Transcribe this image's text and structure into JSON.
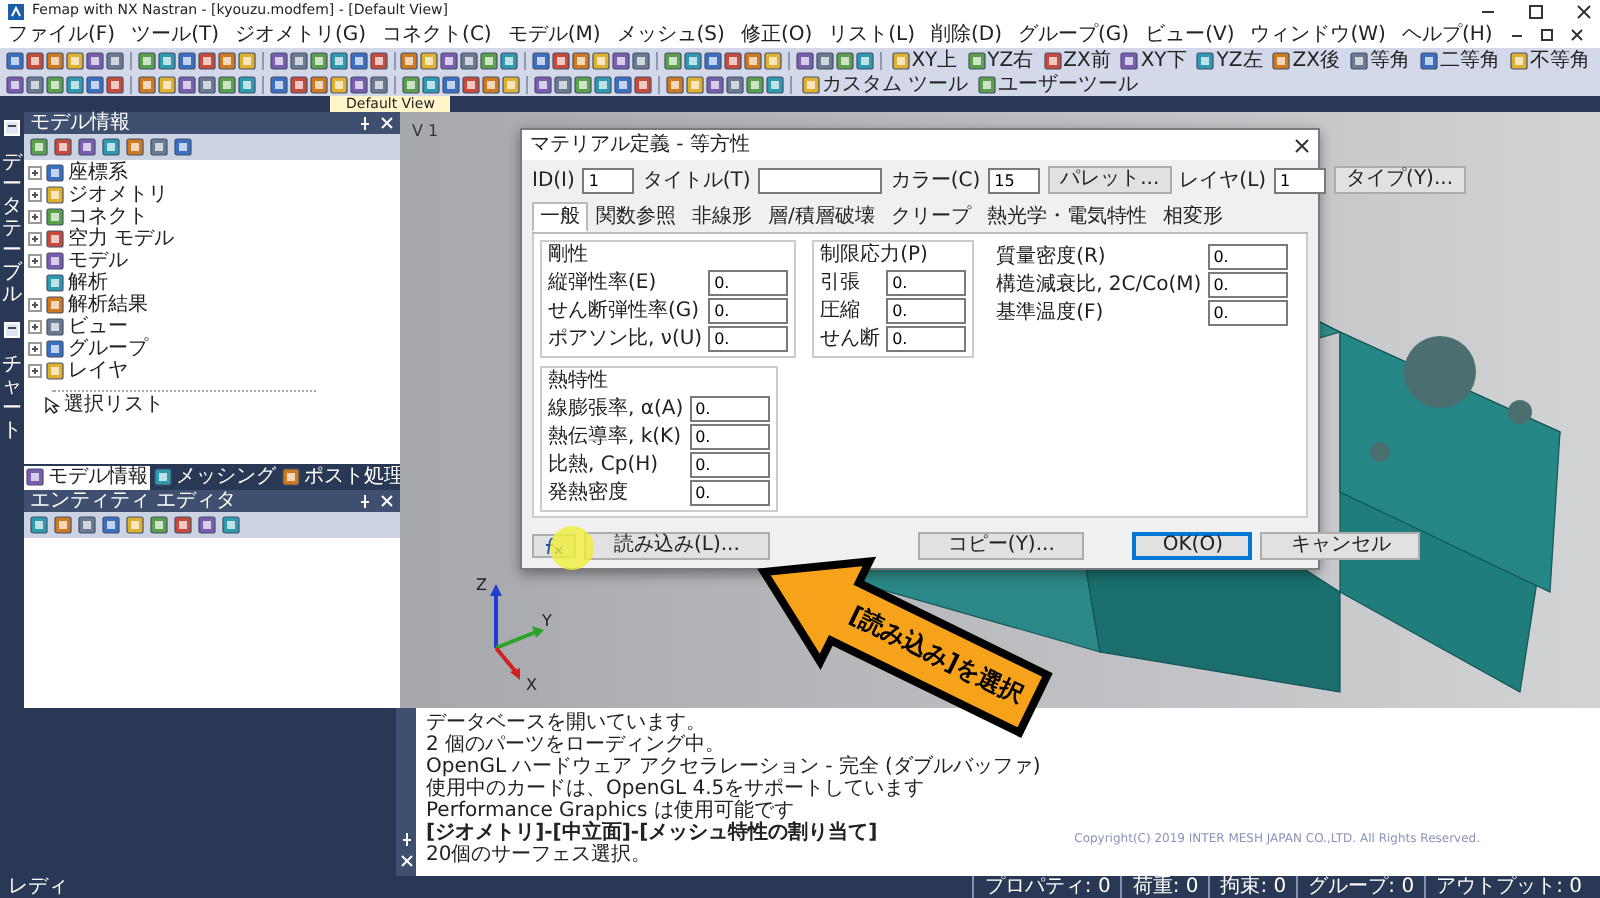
{
  "window": {
    "title": "Femap with NX Nastran - [kyouzu.modfem] - [Default View]"
  },
  "menu": [
    "ファイル(F)",
    "ツール(T)",
    "ジオメトリ(G)",
    "コネクト(C)",
    "モデル(M)",
    "メッシュ(S)",
    "修正(O)",
    "リスト(L)",
    "削除(D)",
    "グループ(G)",
    "ビュー(V)",
    "ウィンドウ(W)",
    "ヘルプ(H)"
  ],
  "view_buttons": [
    "XY上",
    "YZ右",
    "ZX前",
    "XY下",
    "YZ左",
    "ZX後",
    "等角",
    "二等角",
    "不等角"
  ],
  "tool_buttons": [
    "カスタム ツール",
    "ユーザーツール"
  ],
  "view_tabs": [
    {
      "label": "Default View",
      "selected": true
    }
  ],
  "side_tabs": [
    "データテーブル",
    "チャート"
  ],
  "model_info": {
    "title": "モデル情報",
    "tree": [
      {
        "label": "座標系",
        "expandable": true
      },
      {
        "label": "ジオメトリ",
        "expandable": true
      },
      {
        "label": "コネクト",
        "expandable": true
      },
      {
        "label": "空力 モデル",
        "expandable": true
      },
      {
        "label": "モデル",
        "expandable": true
      },
      {
        "label": "解析",
        "expandable": false
      },
      {
        "label": "解析結果",
        "expandable": true
      },
      {
        "label": "ビュー",
        "expandable": true
      },
      {
        "label": "グループ",
        "expandable": true
      },
      {
        "label": "レイヤ",
        "expandable": true
      }
    ],
    "select_list": "選択リスト",
    "tabs": [
      {
        "label": "モデル情報",
        "selected": true
      },
      {
        "label": "メッシング",
        "selected": false
      },
      {
        "label": "ポスト処理",
        "selected": false
      }
    ]
  },
  "entity_editor": {
    "title": "エンティティ エディタ"
  },
  "viewport": {
    "label": "V 1",
    "axes": [
      "Z",
      "Y",
      "X"
    ]
  },
  "dialog": {
    "title": "マテリアル定義 - 等方性",
    "header_fields": [
      {
        "label": "ID(I)",
        "value": "1",
        "kind": "short"
      },
      {
        "label": "タイトル(T)",
        "kind": "long"
      },
      {
        "label": "カラー(C)",
        "value": "15",
        "kind": "short"
      },
      {
        "label": "パレット...",
        "kind": "button"
      },
      {
        "label": "レイヤ(L)",
        "value": "1",
        "kind": "short"
      },
      {
        "label": "タイプ(Y)...",
        "kind": "button"
      }
    ],
    "tabs": [
      {
        "label": "一般",
        "selected": true
      },
      {
        "label": "関数参照",
        "selected": false
      },
      {
        "label": "非線形",
        "selected": false
      },
      {
        "label": "層/積層破壊",
        "selected": false
      },
      {
        "label": "クリープ",
        "selected": false
      },
      {
        "label": "熱光学・電気特性",
        "selected": false
      },
      {
        "label": "相変形",
        "selected": false
      }
    ],
    "field_rows": [
      {
        "groups": [
          {
            "title": "剛性",
            "fields": [
              {
                "label": "縦弾性率(E)",
                "value": "0."
              },
              {
                "label": "せん断弾性率(G)",
                "value": "0."
              },
              {
                "label": "ポアソン比, ν(U)",
                "value": "0."
              }
            ]
          },
          {
            "title": "制限応力(P)",
            "fields": [
              {
                "label": "引張",
                "value": "0."
              },
              {
                "label": "圧縮",
                "value": "0."
              },
              {
                "label": "せん断",
                "value": "0."
              }
            ]
          },
          {
            "fields": [
              {
                "label": "質量密度(R)",
                "value": "0."
              },
              {
                "label": "構造減衰比, 2C/Co(M)",
                "value": "0."
              },
              {
                "label": "基準温度(F)",
                "value": "0."
              }
            ]
          }
        ]
      },
      {
        "groups": [
          {
            "title": "熱特性",
            "fields": [
              {
                "label": "線膨張率, α(A)",
                "value": "0."
              },
              {
                "label": "熱伝導率, k(K)",
                "value": "0."
              },
              {
                "label": "比熱, Cp(H)",
                "value": "0."
              },
              {
                "label": "発熱密度",
                "value": "0."
              }
            ]
          }
        ]
      }
    ],
    "buttons": [
      {
        "label": "読み込み(L)...",
        "default": false
      },
      {
        "label": "コピー(Y)...",
        "default": false
      },
      {
        "label": "OK(O)",
        "default": true
      },
      {
        "label": "キャンセル",
        "default": false
      }
    ]
  },
  "callout": {
    "text": "[読み込み]を選択"
  },
  "messages": {
    "lines": [
      {
        "text": "データベースを開いています。",
        "bold": false
      },
      {
        "text": "2 個のパーツをローディング中。",
        "bold": false
      },
      {
        "text": "OpenGL ハードウェア アクセラレーション - 完全 (ダブルバッファ)",
        "bold": false
      },
      {
        "text": "使用中のカードは、OpenGL 4.5をサポートしています",
        "bold": false
      },
      {
        "text": "Performance Graphics は使用可能です",
        "bold": false
      },
      {
        "text": "[ジオメトリ]-[中立面]-[メッシュ特性の割り当て]",
        "bold": true
      },
      {
        "text": "20個のサーフェス選択。",
        "bold": false
      }
    ],
    "copyright": "Copyright(C) 2019 INTER MESH JAPAN CO.,LTD. All Rights Reserved."
  },
  "status_bar": {
    "left": "レディ",
    "items": [
      "プロパティ: 0",
      "荷重: 0",
      "拘束: 0",
      "グループ: 0",
      "アウトプット: 0"
    ]
  }
}
